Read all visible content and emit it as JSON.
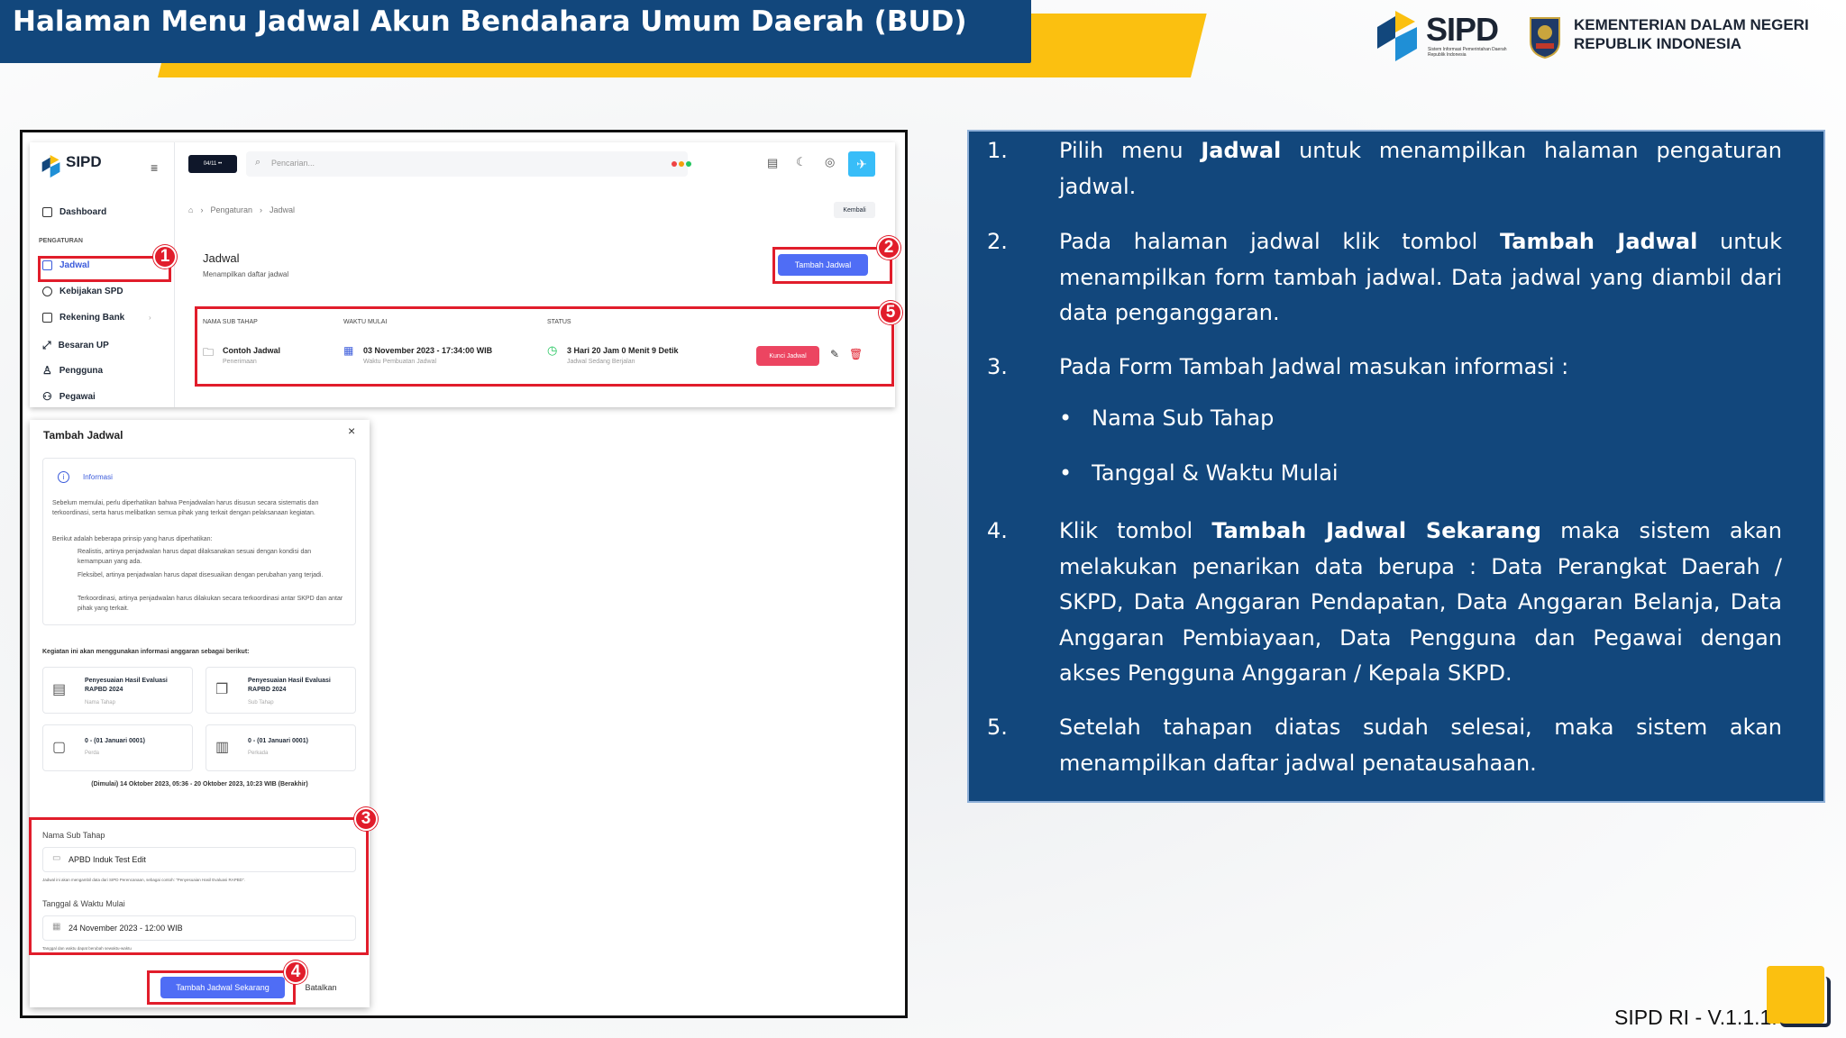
{
  "header": {
    "title": "Halaman Menu Jadwal Akun Bendahara Umum Daerah (BUD)"
  },
  "brand": {
    "sipd_logo": "SIPD",
    "sipd_tagline": "Sistem Informasi Pemerintahan Daerah Republik Indonesia",
    "ministry_line1": "KEMENTERIAN DALAM NEGERI",
    "ministry_line2": "REPUBLIK INDONESIA"
  },
  "app": {
    "logo": "SIPD",
    "year_badge": "04/11 ••",
    "search_placeholder": "Pencarian...",
    "sidebar": {
      "dashboard": "Dashboard",
      "section": "PENGATURAN",
      "items": [
        "Jadwal",
        "Kebijakan SPD",
        "Rekening Bank",
        "Besaran UP",
        "Pengguna",
        "Pegawai"
      ]
    },
    "breadcrumb": [
      "Pengaturan",
      "Jadwal"
    ],
    "back_button": "Kembali",
    "page_title": "Jadwal",
    "page_subtitle": "Menampilkan daftar jadwal",
    "add_button": "Tambah Jadwal",
    "table": {
      "headers": [
        "NAMA SUB TAHAP",
        "WAKTU MULAI",
        "STATUS"
      ],
      "row": {
        "name": "Contoh Jadwal",
        "name_sub": "Penerimaan",
        "time": "03 November 2023 - 17:34:00 WIB",
        "time_sub": "Waktu Pembuatan Jadwal",
        "status": "3 Hari 20 Jam 0 Menit 9 Detik",
        "status_sub": "Jadwal Sedang Berjalan",
        "lock_button": "Kunci Jadwal"
      }
    }
  },
  "modal": {
    "title": "Tambah Jadwal",
    "info_title": "Informasi",
    "info_p1": "Sebelum memulai, perlu diperhatikan bahwa Penjadwalan harus disusun secara sistematis dan terkoordinasi, serta harus melibatkan semua pihak yang terkait dengan pelaksanaan kegiatan.",
    "info_p2": "Berikut adalah beberapa prinsip yang harus diperhatikan:",
    "info_b1": "Realistis, artinya penjadwalan harus dapat dilaksanakan sesuai dengan kondisi dan kemampuan yang ada.",
    "info_b2": "Fleksibel, artinya penjadwalan harus dapat disesuaikan dengan perubahan yang terjadi.",
    "info_b3": "Terkoordinasi, artinya penjadwalan harus dilakukan secara terkoordinasi antar SKPD dan antar pihak yang terkait.",
    "uses_label": "Kegiatan ini akan menggunakan informasi anggaran sebagai berikut:",
    "cards": [
      {
        "title": "Penyesuaian Hasil Evaluasi RAPBD 2024",
        "sub": "Nama Tahap"
      },
      {
        "title": "Penyesuaian Hasil Evaluasi RAPBD 2024",
        "sub": "Sub Tahap"
      },
      {
        "title": "0 - (01 Januari 0001)",
        "sub": "Perda"
      },
      {
        "title": "0 - (01 Januari 0001)",
        "sub": "Perkada"
      }
    ],
    "range": "(Dimulai) 14 Oktober 2023, 05:36 - 20 Oktober 2023, 10:23 WIB (Berakhir)",
    "field1_label": "Nama Sub Tahap",
    "field1_value": "APBD Induk Test Edit",
    "field1_hint": "Jadwal ini akan mengambil data dari SIPD Perencanaan, sebagai contoh: \"Penyesuaian Hasil Evaluasi RAPBD\".",
    "field2_label": "Tanggal & Waktu Mulai",
    "field2_value": "24 November 2023 - 12:00 WIB",
    "field2_hint": "Tanggal dan waktu dapat berubah sewaktu-waktu",
    "submit": "Tambah Jadwal Sekarang",
    "cancel": "Batalkan"
  },
  "badges": [
    "1",
    "2",
    "3",
    "4",
    "5"
  ],
  "steps": [
    {
      "num": "1.",
      "pre": "Pilih menu ",
      "bold": "Jadwal",
      "post": " untuk menampilkan halaman pengaturan jadwal."
    },
    {
      "num": "2.",
      "pre": "Pada halaman  jadwal klik tombol ",
      "bold": "Tambah Jadwal",
      "post": " untuk menampilkan form tambah jadwal. Data jadwal yang diambil dari data penganggaran."
    },
    {
      "num": "3.",
      "pre": "Pada Form Tambah Jadwal masukan informasi :",
      "bold": "",
      "post": ""
    },
    {
      "num": "4.",
      "pre": "Klik tombol ",
      "bold": "Tambah Jadwal Sekarang",
      "post": " maka sistem akan melakukan penarikan data berupa : Data Perangkat Daerah / SKPD, Data Anggaran Pendapatan, Data Anggaran Belanja, Data Anggaran Pembiayaan, Data Pengguna dan Pegawai dengan akses Pengguna Anggaran / Kepala SKPD."
    },
    {
      "num": "5.",
      "pre": "Setelah tahapan diatas sudah selesai, maka sistem akan menampilkan daftar jadwal penatausahaan.",
      "bold": "",
      "post": ""
    }
  ],
  "bullets": [
    "Nama Sub Tahap",
    "Tanggal & Waktu Mulai"
  ],
  "version": "SIPD RI - V.1.1.1.",
  "colors": {
    "navy": "#12477c",
    "yellow": "#fbc010",
    "red": "#e11d2b",
    "button_blue": "#4f6df5",
    "lock_pink": "#ec4561"
  }
}
